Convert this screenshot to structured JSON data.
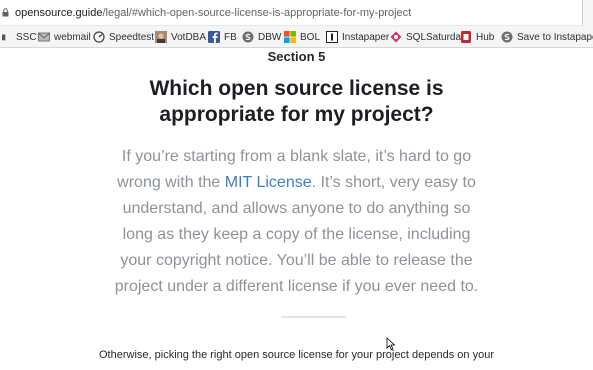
{
  "browser": {
    "url_host": "opensource.guide",
    "url_path": "/legal/#which-open-source-license-is-appropriate-for-my-project"
  },
  "bookmarks": [
    {
      "label": "SSC",
      "icon": "app-grid-icon"
    },
    {
      "label": "webmail",
      "icon": "mail-icon"
    },
    {
      "label": "Speedtest",
      "icon": "speedometer-icon"
    },
    {
      "label": "VotDBA",
      "icon": "profile-photo-icon"
    },
    {
      "label": "FB",
      "icon": "facebook-icon"
    },
    {
      "label": "DBW",
      "icon": "circle-s-icon"
    },
    {
      "label": "BOL",
      "icon": "windows-logo-icon"
    },
    {
      "label": "Instapaper",
      "icon": "instapaper-icon"
    },
    {
      "label": "SQLSaturday",
      "icon": "sqlsaturday-icon"
    },
    {
      "label": "Hub",
      "icon": "hub-icon"
    },
    {
      "label": "Save to Instapaper",
      "icon": "circle-s-icon"
    }
  ],
  "page": {
    "section_label": "Section 5",
    "heading": "Which open source license is appropriate for my project?",
    "lead_before_link": "If you’re starting from a blank slate, it’s hard to go wrong with the ",
    "lead_link": "MIT License",
    "lead_after_link": ". It’s short, very easy to understand, and allows anyone to do anything so long as they keep a copy of the license, including your copyright notice. You’ll be able to release the project under a different license if you ever need to.",
    "paragraph": "Otherwise, picking the right open source license for your project depends on your"
  },
  "colors": {
    "link": "#3d7ec9",
    "lead_text": "#8c939a",
    "heading": "#1b1f23",
    "bookmarks_bar": "#f4f5f7"
  }
}
